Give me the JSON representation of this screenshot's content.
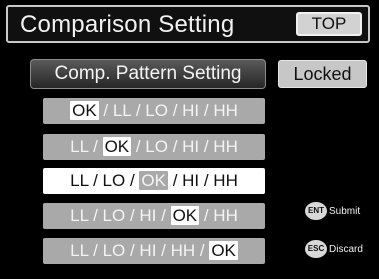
{
  "header": {
    "title": "Comparison Setting",
    "top_label": "TOP"
  },
  "controls": {
    "pattern_label": "Comp. Pattern Setting",
    "locked_label": "Locked"
  },
  "options": [
    {
      "before": "",
      "ok": "OK",
      "after": " / LL / LO / HI / HH",
      "selected": false
    },
    {
      "before": "LL / ",
      "ok": "OK",
      "after": " / LO / HI / HH",
      "selected": false
    },
    {
      "before": "LL / LO / ",
      "ok": "OK",
      "after": " / HI / HH",
      "selected": true
    },
    {
      "before": "LL / LO / HI / ",
      "ok": "OK",
      "after": " / HH",
      "selected": false
    },
    {
      "before": "LL / LO / HI / HH / ",
      "ok": "OK",
      "after": "",
      "selected": false
    }
  ],
  "keys": {
    "ent": {
      "icon": "ENT",
      "label": "Submit"
    },
    "esc": {
      "icon": "ESC",
      "label": "Discard"
    }
  }
}
